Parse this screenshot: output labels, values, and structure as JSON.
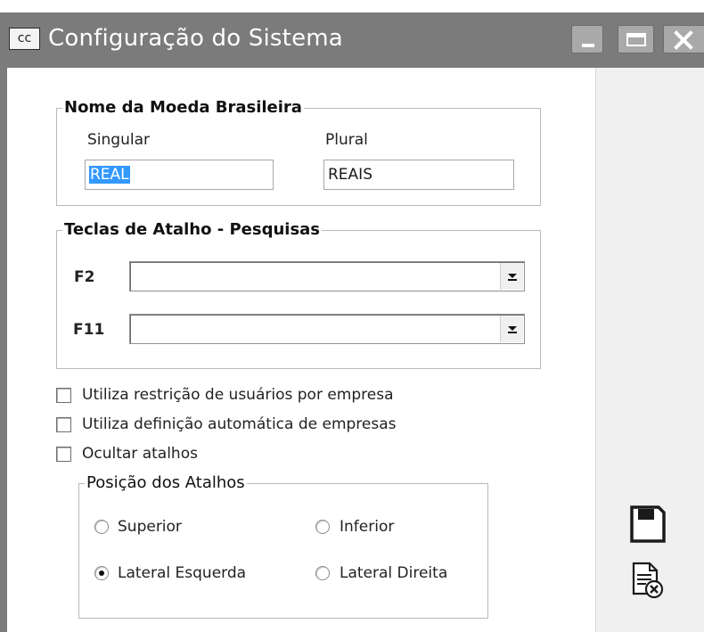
{
  "window": {
    "app_icon_text": "cc",
    "title": "Configuração do Sistema"
  },
  "moeda": {
    "group_title": "Nome da Moeda Brasileira",
    "singular_label": "Singular",
    "singular_value": "REAL",
    "plural_label": "Plural",
    "plural_value": "REAIS"
  },
  "atalhos": {
    "group_title": "Teclas de Atalho - Pesquisas",
    "f2_label": "F2",
    "f2_value": "",
    "f11_label": "F11",
    "f11_value": ""
  },
  "options": [
    {
      "label": "Utiliza restrição de usuários por empresa",
      "checked": false
    },
    {
      "label": "Utiliza definição automática de empresas",
      "checked": false
    },
    {
      "label": "Ocultar atalhos",
      "checked": false
    }
  ],
  "posicao": {
    "group_title": "Posição dos Atalhos",
    "radios": [
      {
        "label": "Superior",
        "checked": false
      },
      {
        "label": "Inferior",
        "checked": false
      },
      {
        "label": "Lateral Esquerda",
        "checked": true
      },
      {
        "label": "Lateral Direita",
        "checked": false
      }
    ]
  },
  "side_icons": [
    "save-icon",
    "cancel-document-icon"
  ],
  "colors": {
    "titlebar": "#7b7b7b",
    "selection": "#3399ff"
  }
}
